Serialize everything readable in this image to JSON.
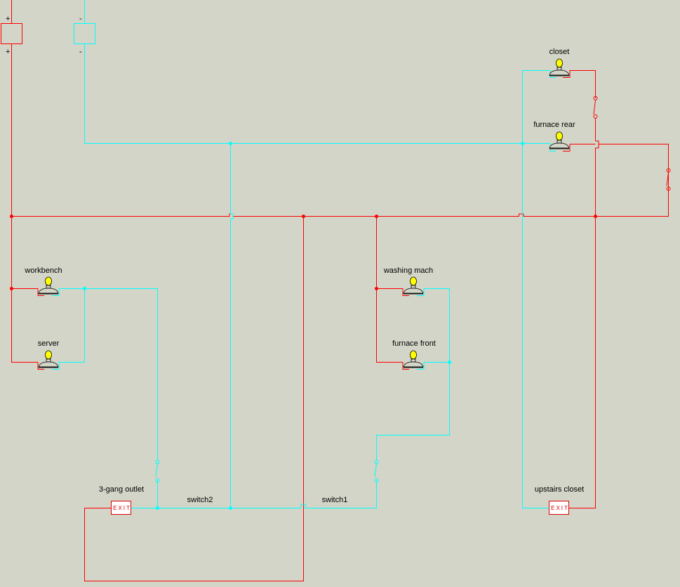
{
  "diagram": {
    "type": "wiring schematic",
    "colors": {
      "background": "#d2d5c7",
      "positive_wire": "#ff0000",
      "negative_wire": "#00ffff",
      "bulb": "#ffff00",
      "exit_sign": "#e00000"
    },
    "battery": {
      "positive_label_top": "+",
      "positive_label_bottom": "+",
      "negative_label_top": "-",
      "negative_label_bottom": "-"
    },
    "lights": [
      {
        "id": "closet",
        "label": "closet"
      },
      {
        "id": "furnace-rear",
        "label": "furnace rear"
      },
      {
        "id": "workbench",
        "label": "workbench"
      },
      {
        "id": "server",
        "label": "server"
      },
      {
        "id": "washing-mach",
        "label": "washing mach"
      },
      {
        "id": "furnace-front",
        "label": "furnace front"
      }
    ],
    "exits": [
      {
        "id": "3-gang-outlet",
        "label": "3-gang outlet",
        "sign": "EXIT"
      },
      {
        "id": "upstairs-closet",
        "label": "upstairs closet",
        "sign": "EXIT"
      }
    ],
    "switches": [
      {
        "id": "switch2",
        "label": "switch2"
      },
      {
        "id": "switch1",
        "label": "switch1"
      }
    ]
  }
}
